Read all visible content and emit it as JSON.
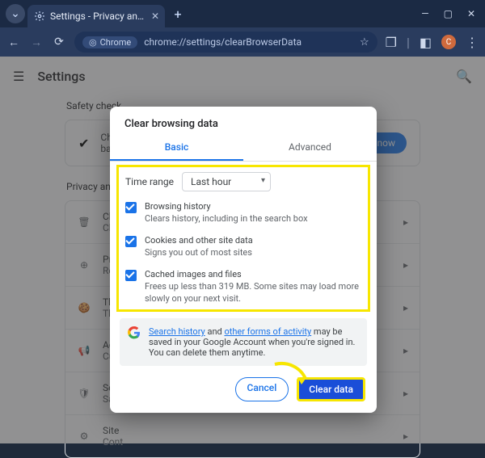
{
  "window": {
    "tab_title": "Settings - Privacy and security",
    "minimize_glyph": "—",
    "maximize_glyph": "▢",
    "close_glyph": "✕",
    "tab_dropdown_glyph": "⌄",
    "newtab_glyph": "+",
    "tab_close_glyph": "✕"
  },
  "toolbar": {
    "back_glyph": "←",
    "forward_glyph": "→",
    "reload_glyph": "⟳",
    "chip_icon": "◎",
    "chip_label": "Chrome",
    "url": "chrome://settings/clearBrowserData",
    "star_glyph": "☆",
    "ext_glyph": "❐",
    "panel_glyph": "◧",
    "avatar_initial": "C",
    "menu_glyph": "⋮"
  },
  "page": {
    "menu_glyph": "☰",
    "title": "Settings",
    "search_glyph": "🔍",
    "safety_section": "Safety check",
    "safety_icon": "✔",
    "safety_message": "Chrome can help keep you safe from data breaches, bad extensions, and more",
    "safety_button": "Check now",
    "privacy_section": "Privacy and security",
    "rows": [
      {
        "icon": "🗑",
        "title": "Clear",
        "sub": "Clear"
      },
      {
        "icon": "⊕",
        "title": "Priva",
        "sub": "Revi"
      },
      {
        "icon": "🍪",
        "title": "Third",
        "sub": "Third"
      },
      {
        "icon": "📢",
        "title": "Ad p",
        "sub": "Cust"
      },
      {
        "icon": "🛡",
        "title": "Secu",
        "sub": "Safe"
      },
      {
        "icon": "⚙",
        "title": "Site",
        "sub": "Cont"
      }
    ],
    "row_chev": "▸"
  },
  "dialog": {
    "title": "Clear browsing data",
    "tab_basic": "Basic",
    "tab_advanced": "Advanced",
    "time_range_label": "Time range",
    "time_range_value": "Last hour",
    "options": [
      {
        "title": "Browsing history",
        "desc": "Clears history, including in the search box"
      },
      {
        "title": "Cookies and other site data",
        "desc": "Signs you out of most sites"
      },
      {
        "title": "Cached images and files",
        "desc": "Frees up less than 319 MB. Some sites may load more slowly on your next visit."
      }
    ],
    "info_link1": "Search history",
    "info_mid": " and ",
    "info_link2": "other forms of activity",
    "info_rest": " may be saved in your Google Account when you're signed in. You can delete them anytime.",
    "cancel": "Cancel",
    "clear": "Clear data"
  }
}
